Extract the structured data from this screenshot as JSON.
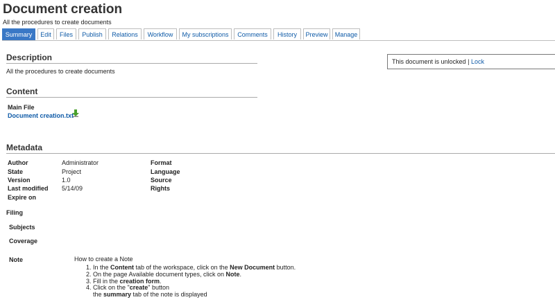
{
  "page": {
    "title": "Document creation",
    "subtitle": "All the procedures to create documents"
  },
  "tabs": [
    {
      "label": "Summary"
    },
    {
      "label": "Edit"
    },
    {
      "label": "Files"
    },
    {
      "label": "Publish"
    },
    {
      "label": "Relations"
    },
    {
      "label": "Workflow"
    },
    {
      "label": "My subscriptions"
    },
    {
      "label": "Comments"
    },
    {
      "label": "History"
    },
    {
      "label": "Preview"
    },
    {
      "label": "Manage"
    }
  ],
  "active_tab": "Summary",
  "description": {
    "heading": "Description",
    "text": "All the procedures to create documents"
  },
  "lock": {
    "status": "This document is unlocked",
    "separator": "|",
    "action": "Lock"
  },
  "content": {
    "heading": "Content",
    "main_file_label": "Main File",
    "file_name": "Document creation.txt",
    "download_icon": "download-arrow-icon"
  },
  "metadata": {
    "heading": "Metadata",
    "author_label": "Author",
    "author": "Administrator",
    "state_label": "State",
    "state": "Project",
    "version_label": "Version",
    "version": "1.0",
    "modified_label": "Last modified",
    "modified": "5/14/09",
    "expire_label": "Expire on",
    "format_label": "Format",
    "language_label": "Language",
    "source_label": "Source",
    "rights_label": "Rights",
    "filing_label": "Filing",
    "subjects_label": "Subjects",
    "coverage_label": "Coverage",
    "note_label": "Note",
    "note_title": "How to create a Note",
    "note_steps": [
      {
        "a": "In the ",
        "b": "Content",
        "c": " tab of the workspace, click on the ",
        "d": "New Document",
        "e": " button."
      },
      {
        "a": "On the page Available document types, click on ",
        "b": "Note",
        "c": "."
      },
      {
        "a": "Fill in the ",
        "b": "creation form",
        "c": "."
      },
      {
        "a": "Click on the \"",
        "b": "create",
        "c": "\" button"
      }
    ],
    "note_tail": {
      "a": "the ",
      "b": "summary",
      "c": " tab of the note is displayed"
    }
  }
}
